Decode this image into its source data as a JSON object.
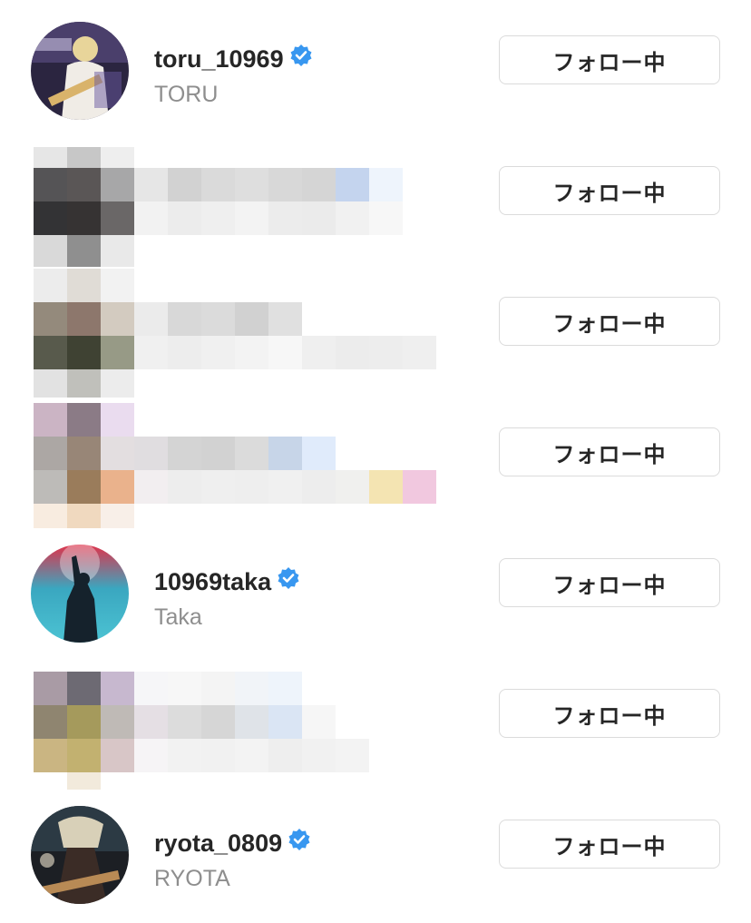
{
  "rows": [
    {
      "username": "toru_10969",
      "fullname": "TORU",
      "verified": true,
      "button": "フォロー中",
      "avatar": "guitarist-photo"
    },
    {
      "username": "",
      "fullname": "",
      "verified": false,
      "button": "フォロー中",
      "avatar": "pixelated"
    },
    {
      "username": "",
      "fullname": "",
      "verified": false,
      "button": "フォロー中",
      "avatar": "pixelated"
    },
    {
      "username": "",
      "fullname": "",
      "verified": false,
      "button": "フォロー中",
      "avatar": "pixelated"
    },
    {
      "username": "10969taka",
      "fullname": "Taka",
      "verified": true,
      "button": "フォロー中",
      "avatar": "singer-photo"
    },
    {
      "username": "",
      "fullname": "",
      "verified": false,
      "button": "フォロー中",
      "avatar": "pixelated"
    },
    {
      "username": "ryota_0809",
      "fullname": "RYOTA",
      "verified": true,
      "button": "フォロー中",
      "avatar": "bassist-photo"
    }
  ],
  "colors": {
    "verified": "#3897f0",
    "username": "#262626",
    "fullname": "#8e8e8e",
    "button_border": "#dbdbdb"
  }
}
